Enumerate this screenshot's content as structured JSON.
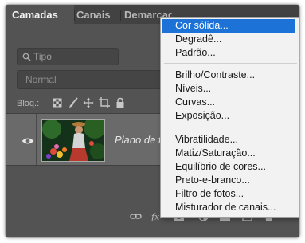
{
  "tabs": [
    {
      "label": "Camadas"
    },
    {
      "label": "Canais"
    },
    {
      "label": "Demarcadores"
    }
  ],
  "search": {
    "placeholder": "Tipo"
  },
  "blend_mode": {
    "value": "Normal"
  },
  "lock": {
    "label": "Bloq.:"
  },
  "layer": {
    "name": "Plano de fundo"
  },
  "menu": {
    "groups": [
      [
        {
          "label": "Cor sólida...",
          "selected": true
        },
        {
          "label": "Degradê..."
        },
        {
          "label": "Padrão..."
        }
      ],
      [
        {
          "label": "Brilho/Contraste..."
        },
        {
          "label": "Níveis..."
        },
        {
          "label": "Curvas..."
        },
        {
          "label": "Exposição..."
        }
      ],
      [
        {
          "label": "Vibratilidade..."
        },
        {
          "label": "Matiz/Saturação..."
        },
        {
          "label": "Equilíbrio de cores..."
        },
        {
          "label": "Preto-e-branco..."
        },
        {
          "label": "Filtro de fotos..."
        },
        {
          "label": "Misturador de canais..."
        }
      ]
    ]
  },
  "colors": {
    "panel_bg": "#535353",
    "tabbar_bg": "#424242",
    "menu_bg": "#f2f2f2",
    "menu_highlight": "#1c72d6"
  },
  "icons": [
    "search-icon",
    "lock-pixels-icon",
    "brush-icon",
    "move-icon",
    "crop-icon",
    "lock-icon",
    "eye-icon",
    "link-icon",
    "fx-icon",
    "mask-icon",
    "adjustment-icon",
    "folder-icon",
    "new-layer-icon",
    "trash-icon"
  ]
}
